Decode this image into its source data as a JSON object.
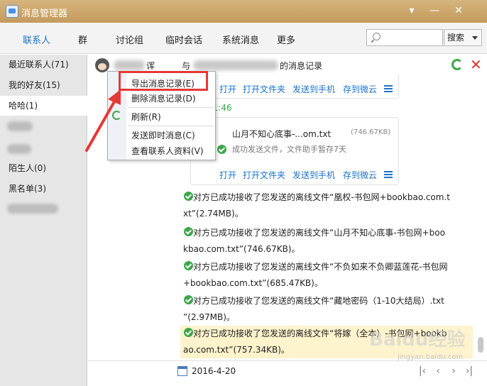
{
  "window": {
    "title": "消息管理器",
    "min": "▾",
    "max": "—",
    "close": "✕"
  },
  "tabs": [
    {
      "label": "联系人",
      "active": true
    },
    {
      "label": "群",
      "active": false
    },
    {
      "label": "讨论组",
      "active": false
    },
    {
      "label": "临时会话",
      "active": false
    },
    {
      "label": "系统消息",
      "active": false
    },
    {
      "label": "更多",
      "active": false
    }
  ],
  "search": {
    "placeholder": "",
    "button": "搜索"
  },
  "sidebar": {
    "items": [
      {
        "label": "最近联系人(71)"
      },
      {
        "label": "我的好友(15)"
      },
      {
        "label": "哈哈(1)",
        "selected": true
      },
      {
        "label": "陌生人(0)"
      },
      {
        "label": "黑名单(3)"
      }
    ]
  },
  "header": {
    "prefix_fragment": "诨",
    "with": "与",
    "suffix": "的消息记录"
  },
  "card1": {
    "actions": [
      "打开",
      "打开文件夹",
      "发送到手机",
      "存到微云"
    ]
  },
  "timestamp": "31:46",
  "card2": {
    "file_name": "山月不知心底事-...om.txt",
    "file_size": "(746.67KB)",
    "status": "成功发送文件，文件助手暂存7天",
    "actions": [
      "打开",
      "打开文件夹",
      "发送到手机",
      "存到微云"
    ]
  },
  "messages": [
    {
      "line1": "对方已成功接收了您发送的离线文件“凰权-书包网+bookbao.com.t",
      "line2": "xt”(2.74MB)。"
    },
    {
      "line1": "对方已成功接收了您发送的离线文件“山月不知心底事-书包网+boo",
      "line2": "kbao.com.txt”(746.67KB)。"
    },
    {
      "line1": "对方已成功接收了您发送的离线文件“不负如来不负卿蓝莲花-书包网",
      "line2": "+bookbao.com.txt”(685.47KB)。"
    },
    {
      "line1": "对方已成功接收了您发送的离线文件“藏地密码（1-10大结局）.txt",
      "line2": "”(2.97MB)。"
    },
    {
      "line1": "对方已成功接收了您发送的离线文件“将嫁（全本）-书包网+bookb",
      "line2": "ao.com.txt”(757.34KB)。"
    }
  ],
  "footer": {
    "date": "2016-4-20"
  },
  "context_menu": {
    "items": [
      "导出消息记录(E)",
      "删除消息记录(D)",
      "刷新(R)",
      "发送即时消息(C)",
      "查看联系人资料(V)"
    ]
  },
  "watermark": {
    "brand": "Baidu经验",
    "url": "jingyan.baidu.com"
  },
  "colors": {
    "accent": "#1b73c9",
    "success": "#3ea64a",
    "highlight": "#e53935"
  }
}
